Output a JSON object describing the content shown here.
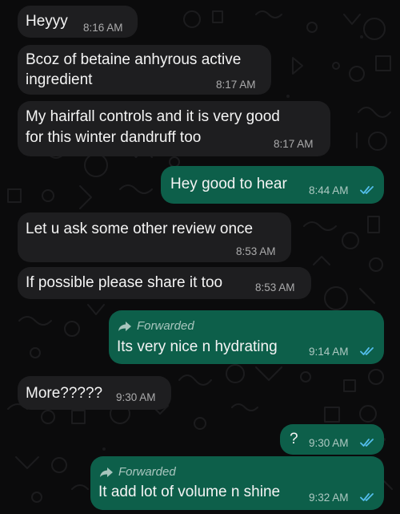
{
  "chat": {
    "messages": [
      {
        "text": "Heyyy",
        "time": "8:16 AM"
      },
      {
        "lines": [
          "Bcoz of betaine anhyrous active",
          "ingredient"
        ],
        "time": "8:17 AM"
      },
      {
        "lines": [
          "My hairfall controls and it is very good",
          "for this winter dandruff too"
        ],
        "time": "8:17 AM"
      },
      {
        "text": "Hey good to hear",
        "time": "8:44 AM"
      },
      {
        "text": "Let u ask some other review once",
        "time": "8:53 AM"
      },
      {
        "text": "If possible please share it too",
        "time": "8:53 AM"
      },
      {
        "forwarded_label": "Forwarded",
        "text": "Its very nice n hydrating",
        "time": "9:14 AM"
      },
      {
        "text": "More?????",
        "time": "9:30 AM"
      },
      {
        "text": "?",
        "time": "9:30 AM"
      },
      {
        "forwarded_label": "Forwarded",
        "text": "It add lot of volume n shine",
        "time": "9:32 AM"
      }
    ]
  },
  "icons": {
    "read_receipt": "double-check-icon",
    "forward": "forward-arrow-icon"
  },
  "colors": {
    "background": "#0b0b0c",
    "incoming_bubble": "#1e1e20",
    "outgoing_bubble": "#0d5f4a",
    "read_tick": "#53bdeb"
  }
}
